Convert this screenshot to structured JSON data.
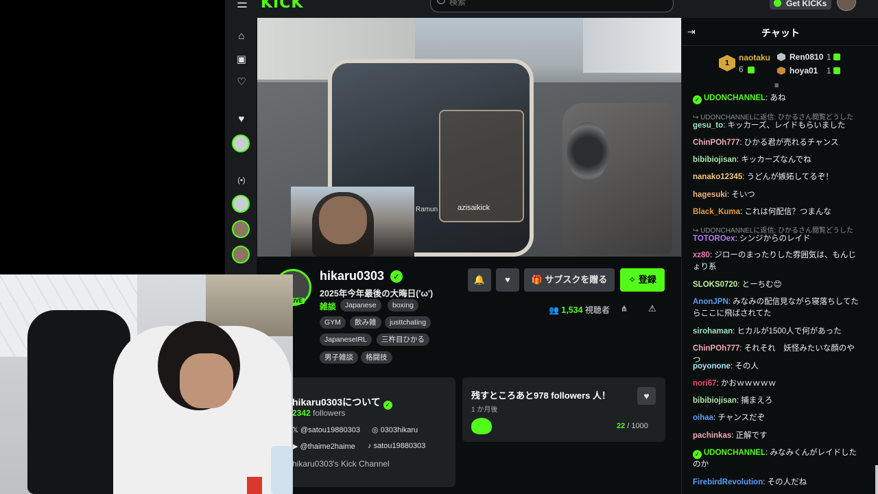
{
  "topbar": {
    "logo": "KICK",
    "search_placeholder": "検索",
    "get_kicks": "Get KICKs"
  },
  "sidebar": {
    "icons": [
      "home-icon",
      "browse-icon",
      "following-icon"
    ]
  },
  "video": {
    "overlay_name": "azisaikick",
    "overlay_label": "Ramun"
  },
  "channel": {
    "name": "hikaru0303",
    "live_label": "LIVE",
    "title": "2025年今年最後の大晦日('ω')",
    "category": "雑談",
    "tags": [
      "Japanese",
      "boxing",
      "GYM",
      "飲み雑",
      "justtchating",
      "JapaneseIRL",
      "三杵目ひかる",
      "男子雑談",
      "格闘技"
    ],
    "gift_sub": "サブスクを贈る",
    "follow": "登録",
    "viewer_count": "1,534",
    "viewer_label": "視聴者"
  },
  "about": {
    "title": "hikaru0303について",
    "followers_count": "2342",
    "followers_label": "followers",
    "socials": {
      "x": "@satou19880303",
      "instagram": "0303hikaru",
      "youtube": "@thaime2haime",
      "tiktok": "satou19880303"
    },
    "description": "hikaru0303's Kick Channel"
  },
  "goal": {
    "title": "残すところあと978 followers 人！",
    "time": "1 か月後",
    "current": "22",
    "target": "/ 1000"
  },
  "chat": {
    "title": "チャット",
    "top_gifters": [
      {
        "rank": "1",
        "name": "naotaku",
        "count": "6"
      },
      {
        "name": "Ren0810",
        "count": "1"
      },
      {
        "name": "hoya01",
        "count": "1"
      }
    ],
    "messages": [
      {
        "user": "UDONCHANNEL",
        "color": "#53fc18",
        "text": "あね",
        "verified": true
      },
      {
        "reply": "UDONCHANNELに返信: ひかるさん閲覧どうした"
      },
      {
        "user": "gesu_to",
        "color": "#9fe3c5",
        "text": "キッカーズ、レイドもらいました"
      },
      {
        "user": "ChinPOh777",
        "color": "#f2a7b8",
        "text": "ひかる君が売れるチャンス"
      },
      {
        "user": "bibibiojisan",
        "color": "#a8e6a3",
        "text": "キッカーズなんでね"
      },
      {
        "user": "nanako12345",
        "color": "#f6c67a",
        "text": "うどんが嫉妬してるぞ！"
      },
      {
        "user": "hagesuki",
        "color": "#f0b07a",
        "text": "そいつ"
      },
      {
        "user": "Black_Kuma",
        "color": "#e0a03a",
        "text": "これは何配信？つまんな"
      },
      {
        "reply": "UDONCHANNELに返信: ひかるさん閲覧どうした"
      },
      {
        "user": "TOTOROex",
        "color": "#b57cf0",
        "text": "シンジからのレイド"
      },
      {
        "user": "xz80",
        "color": "#f07ab8",
        "text": "ジローのまったりした雰囲気は、もんじょり系"
      },
      {
        "user": "SLOKS0720",
        "color": "#b9f3a0",
        "text": "とーちむ😊"
      },
      {
        "user": "AnonJPN",
        "color": "#5f9df7",
        "text": "みなみの配信見ながら寝落ちしてたらここに飛ばされてた"
      },
      {
        "user": "sirohaman",
        "color": "#9fe3c5",
        "text": "ヒカルが1500人で何があった"
      },
      {
        "user": "ChinPOh777",
        "color": "#f2a7b8",
        "text": "それそれ　妖怪みたいな顔のやつ"
      },
      {
        "user": "poyonone",
        "color": "#a8e6f3",
        "text": "その人"
      },
      {
        "user": "nori67",
        "color": "#f0506a",
        "text": "かおｗｗｗｗｗ"
      },
      {
        "user": "bibibiojisan",
        "color": "#a8e6a3",
        "text": "捕まえろ"
      },
      {
        "user": "oihaa",
        "color": "#5f9df7",
        "text": "チャンスだぞ"
      },
      {
        "user": "pachinkas",
        "color": "#f2a7b8",
        "text": "正解です"
      },
      {
        "user": "UDONCHANNEL",
        "color": "#53fc18",
        "text": "みなみくんがレイドしたのか",
        "verified": true
      },
      {
        "user": "FirebirdRevolution",
        "color": "#5f9df7",
        "text": "その人だね"
      }
    ]
  },
  "colors": {
    "accent": "#53fc18",
    "background": "#0b0e0f",
    "panel": "#1e2124"
  }
}
